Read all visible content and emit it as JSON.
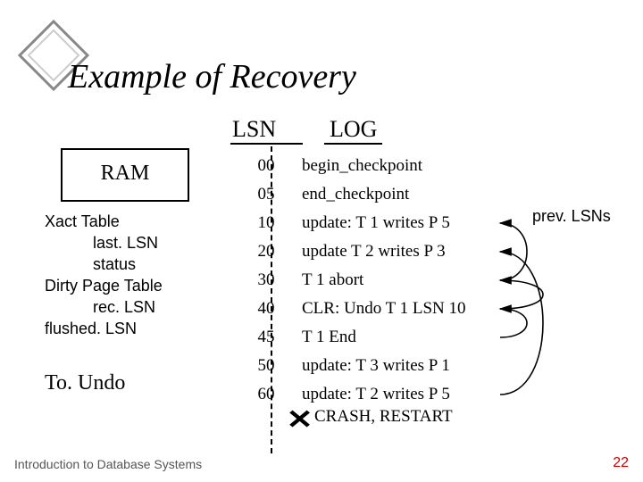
{
  "title": "Example of Recovery",
  "headers": {
    "lsn": "LSN",
    "log": "LOG"
  },
  "ram": {
    "box": "RAM",
    "lines": [
      "Xact Table",
      "last. LSN",
      "status",
      "Dirty Page Table",
      "rec. LSN",
      "flushed. LSN"
    ],
    "indent": [
      0,
      1,
      1,
      0,
      1,
      0
    ],
    "toundo": "To. Undo"
  },
  "log": [
    {
      "lsn": "00",
      "entry": "begin_checkpoint"
    },
    {
      "lsn": "05",
      "entry": "end_checkpoint"
    },
    {
      "lsn": "10",
      "entry": "update: T 1 writes P 5"
    },
    {
      "lsn": "20",
      "entry": "update T 2 writes P 3"
    },
    {
      "lsn": "30",
      "entry": "T 1 abort"
    },
    {
      "lsn": "40",
      "entry": "CLR: Undo T 1 LSN 10"
    },
    {
      "lsn": "45",
      "entry": "T 1 End"
    },
    {
      "lsn": "50",
      "entry": "update: T 3 writes P 1"
    },
    {
      "lsn": "60",
      "entry": "update: T 2 writes P 5"
    }
  ],
  "prev_label": "prev. LSNs",
  "crash": {
    "mark": "✕",
    "label": "CRASH, RESTART"
  },
  "footer": "Introduction to Database Systems",
  "page": "22",
  "arrows": [
    {
      "from_lsn": "30",
      "to_lsn": "10"
    },
    {
      "from_lsn": "40",
      "to_lsn": "30"
    },
    {
      "from_lsn": "45",
      "to_lsn": "40"
    },
    {
      "from_lsn": "60",
      "to_lsn": "20"
    }
  ]
}
